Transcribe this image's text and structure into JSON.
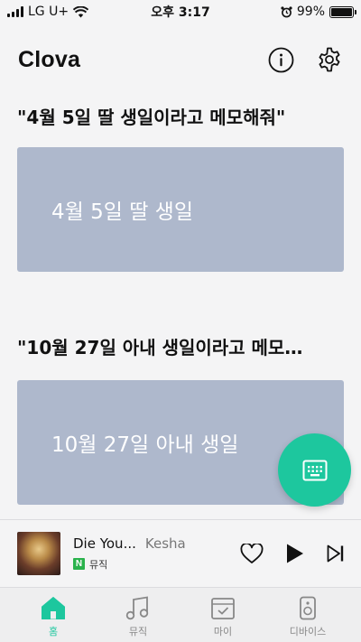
{
  "status_bar": {
    "carrier": "LG U+",
    "time": "오후 3:17",
    "battery": "99%"
  },
  "header": {
    "title": "Clova"
  },
  "cards": [
    {
      "quote": "\"4월 5일 딸 생일이라고 메모해줘\"",
      "memo": "4월 5일 딸 생일"
    },
    {
      "quote": "\"10월 27일 아내 생일이라고 메모…",
      "memo": "10월 27일 아내 생일"
    }
  ],
  "player": {
    "title": "Die You...",
    "artist": "Kesha",
    "service": "뮤직",
    "service_badge": "N"
  },
  "tabs": [
    {
      "label": "홈",
      "icon": "home-icon"
    },
    {
      "label": "뮤직",
      "icon": "music-icon"
    },
    {
      "label": "마이",
      "icon": "my-icon"
    },
    {
      "label": "디바이스",
      "icon": "device-icon"
    }
  ],
  "colors": {
    "accent": "#1dc79e",
    "card": "#aeb8cc",
    "background": "#f4f4f5"
  }
}
